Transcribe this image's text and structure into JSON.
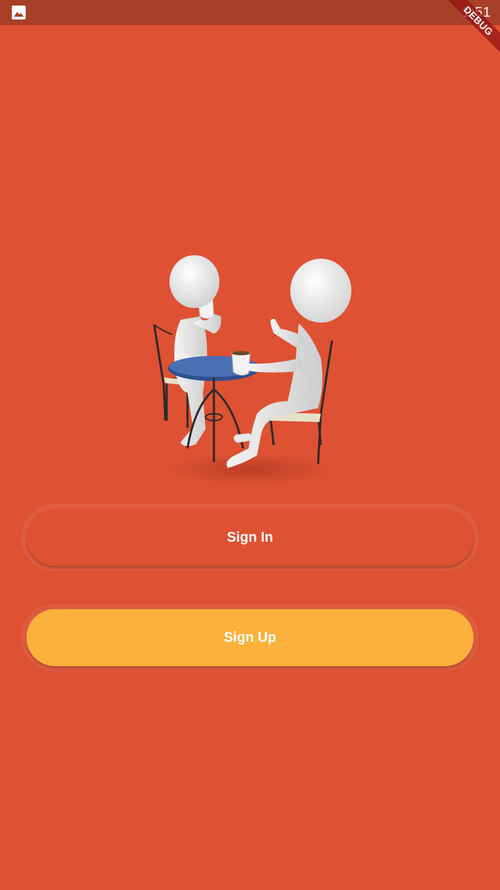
{
  "status_bar": {
    "time": "1:51",
    "notification_icon": "image-icon"
  },
  "debug_banner": {
    "label": "DEBUG"
  },
  "illustration": {
    "icon": "two-people-coffee-table-illustration"
  },
  "buttons": {
    "sign_in": "Sign In",
    "sign_up": "Sign Up"
  },
  "colors": {
    "background": "#DE5133",
    "status_bar": "#A83F27",
    "sign_up_button": "#FBB13C",
    "text": "#FFFFFF"
  }
}
